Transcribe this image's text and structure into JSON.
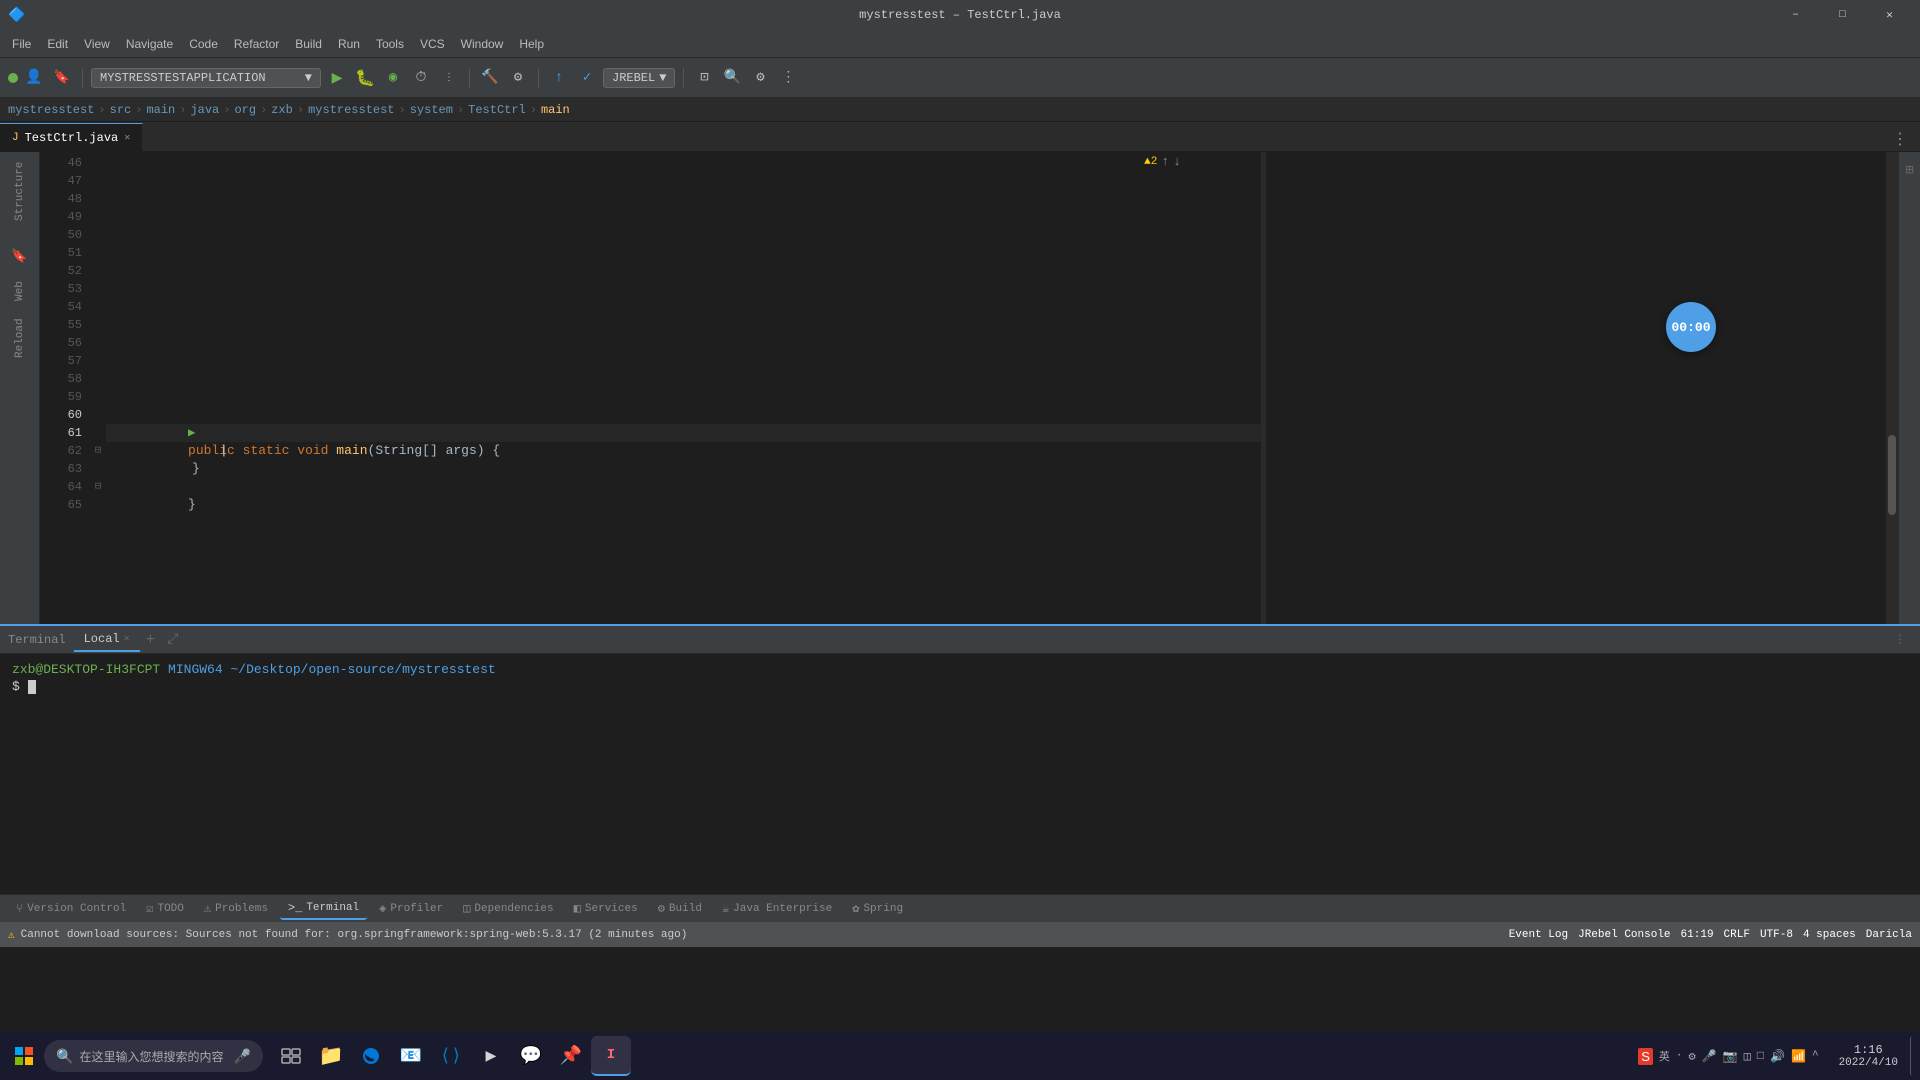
{
  "window": {
    "title": "mystresstest – TestCtrl.java",
    "app_name": "mystresstest"
  },
  "titlebar": {
    "minimize": "–",
    "maximize": "□",
    "close": "✕"
  },
  "menu": {
    "items": [
      "File",
      "Edit",
      "View",
      "Navigate",
      "Code",
      "Refactor",
      "Build",
      "Run",
      "Tools",
      "VCS",
      "Window",
      "Help"
    ]
  },
  "toolbar": {
    "run_config": "MYSTRESSTESTAPPLICATION",
    "jrebel": "JREBEL",
    "timer": "00:00"
  },
  "breadcrumb": {
    "project": "mystresstest",
    "src": "src",
    "main": "main",
    "java": "java",
    "org": "org",
    "zxb": "zxb",
    "mystresstest": "mystresstest",
    "system": "system",
    "class": "TestCtrl",
    "method": "main"
  },
  "tabs": [
    {
      "name": "TestCtrl.java",
      "active": true
    }
  ],
  "code": {
    "lines": [
      {
        "num": 46,
        "content": ""
      },
      {
        "num": 47,
        "content": ""
      },
      {
        "num": 48,
        "content": ""
      },
      {
        "num": 49,
        "content": ""
      },
      {
        "num": 50,
        "content": ""
      },
      {
        "num": 51,
        "content": ""
      },
      {
        "num": 52,
        "content": ""
      },
      {
        "num": 53,
        "content": ""
      },
      {
        "num": 54,
        "content": ""
      },
      {
        "num": 55,
        "content": ""
      },
      {
        "num": 56,
        "content": ""
      },
      {
        "num": 57,
        "content": ""
      },
      {
        "num": 58,
        "content": ""
      },
      {
        "num": 59,
        "content": ""
      },
      {
        "num": 60,
        "content": "    public static void main(String[] args) {",
        "has_run": true
      },
      {
        "num": 61,
        "content": "        ",
        "active": true,
        "has_cursor": true
      },
      {
        "num": 62,
        "content": "    }",
        "fold": true
      },
      {
        "num": 63,
        "content": ""
      },
      {
        "num": 64,
        "content": "}",
        "fold": true
      },
      {
        "num": 65,
        "content": ""
      }
    ]
  },
  "terminal": {
    "title": "Terminal",
    "tab_name": "Local",
    "prompt_user": "zxb@DESKTOP-IH3FCPT",
    "prompt_shell": "MINGW64",
    "prompt_path": "~/Desktop/open-source/mystresstest",
    "command": ""
  },
  "bottom_tools": [
    {
      "name": "Version Control",
      "icon": "⑂",
      "active": false
    },
    {
      "name": "TODO",
      "icon": "☑",
      "active": false
    },
    {
      "name": "Problems",
      "icon": "⚠",
      "active": false
    },
    {
      "name": "Terminal",
      "icon": ">_",
      "active": true
    },
    {
      "name": "Profiler",
      "icon": "◈",
      "active": false
    },
    {
      "name": "Dependencies",
      "icon": "◫",
      "active": false
    },
    {
      "name": "Services",
      "icon": "◧",
      "active": false
    },
    {
      "name": "Build",
      "icon": "⚙",
      "active": false
    },
    {
      "name": "Java Enterprise",
      "icon": "☕",
      "active": false
    },
    {
      "name": "Spring",
      "icon": "✿",
      "active": false
    }
  ],
  "status_bar": {
    "event_log": "Event Log",
    "jrebel_console": "JRebel Console",
    "error_message": "Cannot download sources: Sources not found for: org.springframework:spring-web:5.3.17 (2 minutes ago)",
    "line": "61",
    "col": "19",
    "crlf": "CRLF",
    "encoding": "UTF-8",
    "indent": "4 spaces",
    "git_branch": "Daricla"
  },
  "taskbar": {
    "search_placeholder": "在这里输入您想搜索的内容",
    "time": "1:16",
    "date": "2022/4/10"
  },
  "sidebar_icons": [
    {
      "name": "Structure",
      "label": "Structure"
    },
    {
      "name": "Bookmarks",
      "label": ""
    },
    {
      "name": "Favorites",
      "label": ""
    },
    {
      "name": "Web",
      "label": "Web"
    },
    {
      "name": "Reload",
      "label": "Reload"
    }
  ],
  "colors": {
    "accent": "#4e9fe5",
    "run_green": "#6ab04c",
    "error_red": "#ff6b6b",
    "warn_yellow": "#ffcc00"
  }
}
